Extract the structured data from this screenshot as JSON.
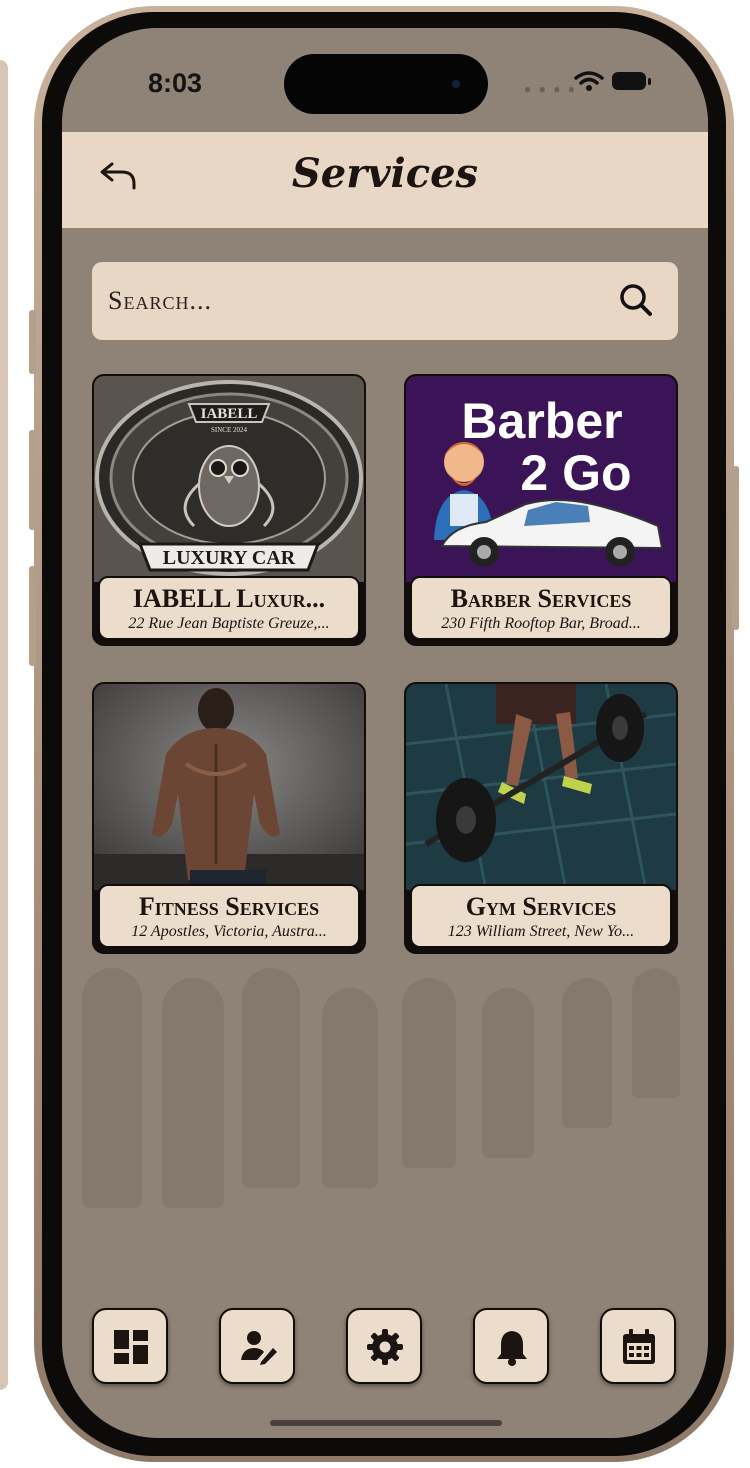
{
  "status": {
    "time": "8:03"
  },
  "header": {
    "title": "Services",
    "back_icon": "back-arrow-icon"
  },
  "search": {
    "placeholder": "Search...",
    "icon": "search-icon"
  },
  "cards": [
    {
      "title": "IABELL Luxur...",
      "address": "22 Rue Jean Baptiste Greuze,...",
      "logo_text_top": "IABELL",
      "logo_text_bottom": "LUXURY CAR",
      "logo_small": "SINCE 2024"
    },
    {
      "title": "Barber Services",
      "address": "230 Fifth Rooftop Bar, Broad...",
      "logo_line1": "Barber",
      "logo_line2": "2 Go"
    },
    {
      "title": "Fitness Services",
      "address": "12 Apostles, Victoria, Austra..."
    },
    {
      "title": "Gym Services",
      "address": "123 William Street, New Yo..."
    }
  ],
  "bottom_nav": [
    {
      "icon": "dashboard-icon"
    },
    {
      "icon": "edit-profile-icon"
    },
    {
      "icon": "settings-gear-icon"
    },
    {
      "icon": "notification-bell-icon"
    },
    {
      "icon": "calendar-icon"
    }
  ],
  "colors": {
    "screen_bg": "#8f8276",
    "panel": "#e8d7c5",
    "ink": "#1c1410",
    "barber_bg": "#3a1456"
  }
}
